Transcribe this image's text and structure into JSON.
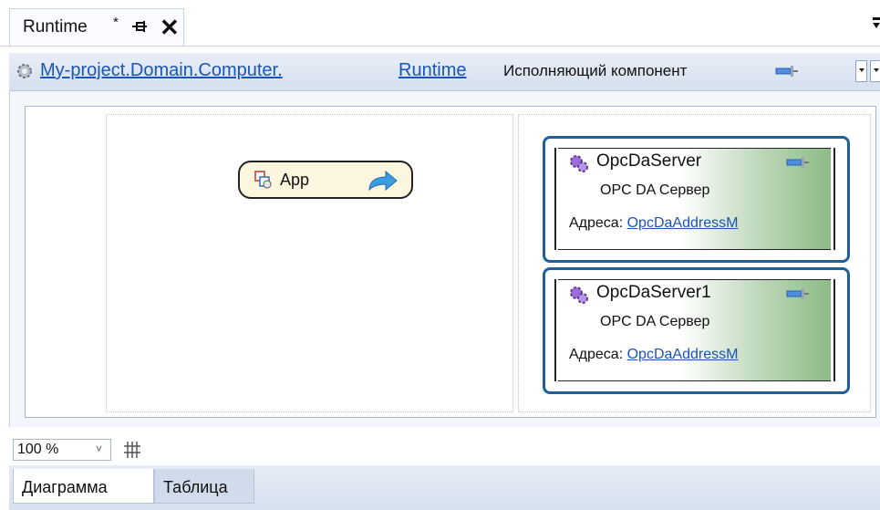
{
  "document_tab": {
    "title": "Runtime",
    "modified_marker": "*",
    "pin_icon": "pin-icon",
    "close_label": "✕"
  },
  "navbar": {
    "breadcrumbs": [
      "My-project.Domain.Computer.",
      "Runtime"
    ],
    "type_label": "Исполняющий компонент"
  },
  "diagram": {
    "app_node": {
      "label": "App"
    },
    "servers": [
      {
        "name": "OpcDaServer",
        "type": "OPC DA Сервер",
        "address_label": "Адреса:",
        "address_link": "OpcDaAddressM"
      },
      {
        "name": "OpcDaServer1",
        "type": "OPC DA Сервер",
        "address_label": "Адреса:",
        "address_link": "OpcDaAddressM"
      }
    ]
  },
  "statusbar": {
    "zoom": "100 %",
    "zoom_chevron": "˅"
  },
  "bottom_tabs": [
    {
      "label": "Диаграмма",
      "active": true
    },
    {
      "label": "Таблица",
      "active": false
    }
  ],
  "colors": {
    "link": "#1a55b8",
    "server_border": "#1f5fa0",
    "server_fill_end": "#8cbb86",
    "app_fill": "#fcf6df"
  }
}
